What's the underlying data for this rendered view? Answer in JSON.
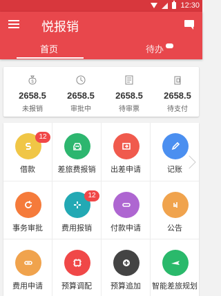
{
  "status_bar": {
    "time": "12:30"
  },
  "app": {
    "title": "悦报销",
    "tabs": [
      {
        "label": "首页",
        "selected": true
      },
      {
        "label": "待办",
        "selected": false
      }
    ]
  },
  "stats": [
    {
      "value": "2658.5",
      "label": "未报销",
      "icon": "money-bag-icon"
    },
    {
      "value": "2658.5",
      "label": "审批中",
      "icon": "clock-icon"
    },
    {
      "value": "2658.5",
      "label": "待审票",
      "icon": "invoice-icon"
    },
    {
      "value": "2658.5",
      "label": "待支付",
      "icon": "payment-icon"
    }
  ],
  "modules": [
    {
      "label": "借款",
      "color": "#f0c646",
      "icon": "dollar-icon",
      "badge": "12"
    },
    {
      "label": "差旅费报销",
      "color": "#2db66f",
      "icon": "car-icon"
    },
    {
      "label": "出差申请",
      "color": "#f05a4d",
      "icon": "arrow-right-box-icon"
    },
    {
      "label": "记账",
      "color": "#4b8ff0",
      "icon": "pencil-icon"
    },
    {
      "label": "事务审批",
      "color": "#f57b3b",
      "icon": "refresh-icon"
    },
    {
      "label": "费用报销",
      "color": "#23a9b4",
      "icon": "gamepad-icon",
      "badge": "12"
    },
    {
      "label": "付款申请",
      "color": "#ae66d1",
      "icon": "link-icon"
    },
    {
      "label": "公告",
      "color": "#f0a34d",
      "icon": "volume-icon"
    },
    {
      "label": "费用申请",
      "color": "#f0a34d",
      "icon": "chain-icon"
    },
    {
      "label": "预算调配",
      "color": "#f04848",
      "icon": "chip-icon"
    },
    {
      "label": "预算追加",
      "color": "#444444",
      "icon": "plus-icon"
    },
    {
      "label": "智能差旅规划",
      "color": "#2ab96b",
      "icon": "airplane-icon"
    }
  ],
  "colors": {
    "primary": "#e8474c",
    "status_bar": "#d8373d"
  }
}
